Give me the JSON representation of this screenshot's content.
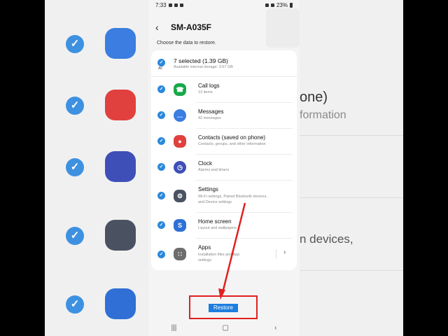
{
  "status_bar": {
    "time": "7:33",
    "battery": "23%"
  },
  "header": {
    "title": "SM-A035F"
  },
  "subtitle": "Choose the data to restore.",
  "select_all": {
    "label": "7 selected (1.39 GB)",
    "sub": "Available internal storage: 3.57 GB",
    "all_label": "All"
  },
  "items": [
    {
      "label": "Call logs",
      "sub": "13 items",
      "icon": "phone-icon",
      "color": "#18a84a"
    },
    {
      "label": "Messages",
      "sub": "42 messages",
      "icon": "chat-bubble-icon",
      "color": "#3b7de0"
    },
    {
      "label": "Contacts (saved on phone)",
      "sub": "Contacts, groups, and other information",
      "icon": "person-icon",
      "color": "#e0413e"
    },
    {
      "label": "Clock",
      "sub": "Alarms and timers",
      "icon": "clock-icon",
      "color": "#3f4fb8"
    },
    {
      "label": "Settings",
      "sub": "Wi-Fi settings, Paired Bluetooth devices,",
      "sub2": "and Device settings",
      "icon": "gear-icon",
      "color": "#4a5262"
    },
    {
      "label": "Home screen",
      "sub": "Layout and wallpapers",
      "icon": "home-screen-icon",
      "color": "#2f6fd6"
    },
    {
      "label": "Apps",
      "sub": "Installation files and App",
      "sub2": "settings",
      "icon": "apps-grid-icon",
      "color": "#6d6d6d"
    }
  ],
  "restore_button": "Restore",
  "background_texts": {
    "right_line1": "one)",
    "right_line2": "formation",
    "right_line3": "n devices,"
  },
  "colors": {
    "accent": "#1d7ee0",
    "annotation": "#e12020"
  }
}
